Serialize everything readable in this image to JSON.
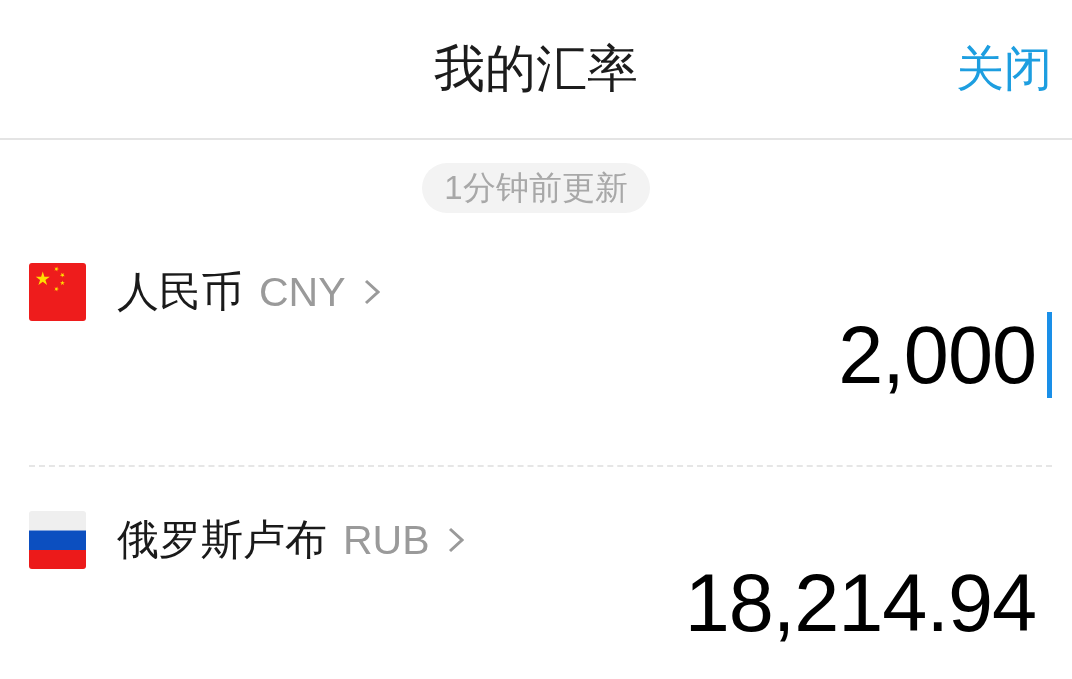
{
  "header": {
    "title": "我的汇率",
    "close_label": "关闭"
  },
  "update_badge": "1分钟前更新",
  "currencies": [
    {
      "kind": "cn",
      "name": "人民币",
      "code": "CNY",
      "amount": "2,000",
      "focused": true
    },
    {
      "kind": "ru",
      "name": "俄罗斯卢布",
      "code": "RUB",
      "amount": "18,214.94",
      "focused": false
    }
  ]
}
